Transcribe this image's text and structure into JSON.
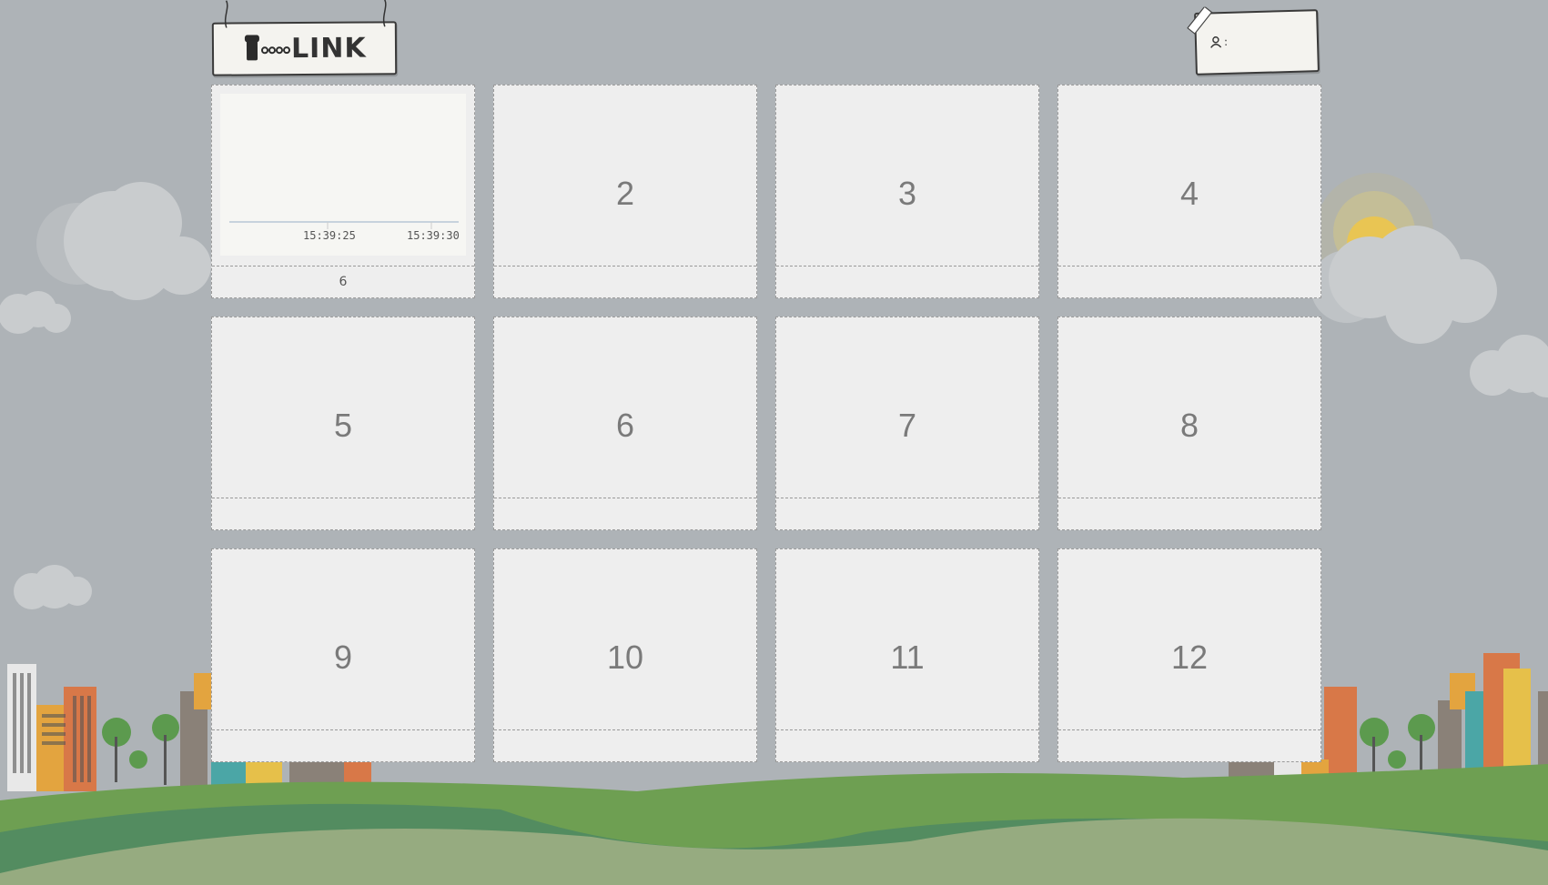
{
  "header": {
    "logo_text": "LINK",
    "user_label": ":"
  },
  "tiles": [
    {
      "label": "",
      "footer": "6",
      "chart": {
        "tick_labels": [
          "15:39:25",
          "15:39:30"
        ]
      }
    },
    {
      "label": "2",
      "footer": ""
    },
    {
      "label": "3",
      "footer": ""
    },
    {
      "label": "4",
      "footer": ""
    },
    {
      "label": "5",
      "footer": ""
    },
    {
      "label": "6",
      "footer": ""
    },
    {
      "label": "7",
      "footer": ""
    },
    {
      "label": "8",
      "footer": ""
    },
    {
      "label": "9",
      "footer": ""
    },
    {
      "label": "10",
      "footer": ""
    },
    {
      "label": "11",
      "footer": ""
    },
    {
      "label": "12",
      "footer": ""
    }
  ],
  "icons": {
    "logo": "plug-icon",
    "user": "user-icon"
  }
}
